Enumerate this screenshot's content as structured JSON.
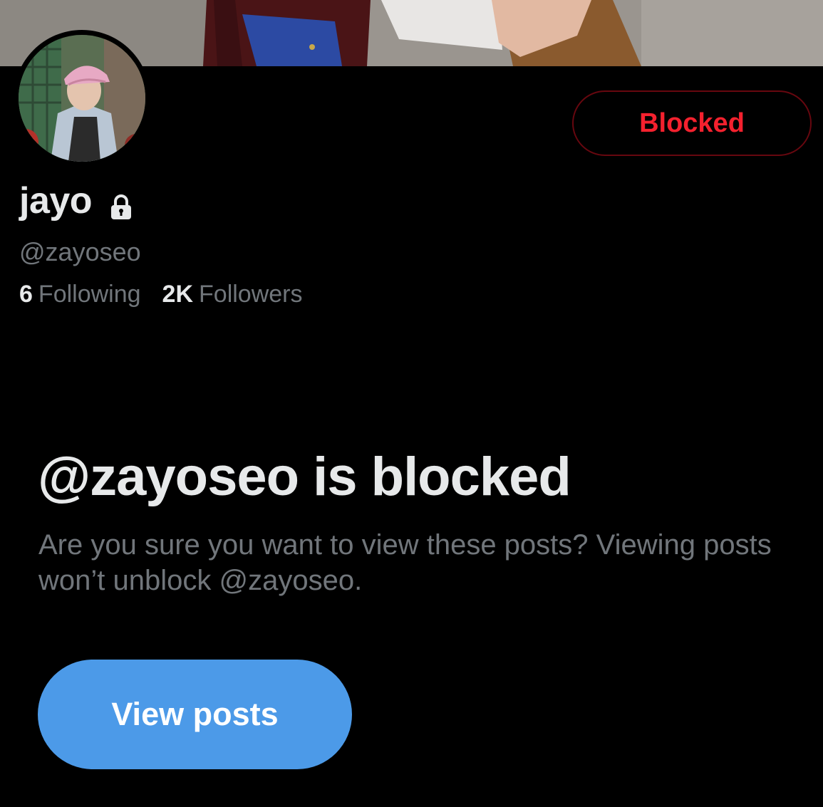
{
  "profile": {
    "display_name": "jayo",
    "handle": "@zayoseo",
    "following_count": "6",
    "following_label": "Following",
    "followers_count": "2K",
    "followers_label": "Followers",
    "block_button_label": "Blocked",
    "lock_icon": "lock-icon"
  },
  "blocked_notice": {
    "title": "@zayoseo is blocked",
    "description": "Are you sure you want to view these posts? Viewing posts won’t unblock @zayoseo.",
    "view_button_label": "View posts"
  },
  "colors": {
    "background": "#000000",
    "primary_text": "#e7e9ea",
    "secondary_text": "#71767b",
    "blocked_red": "#f4212e",
    "blocked_border": "#67070f",
    "accent_blue": "#4c9ae8"
  }
}
